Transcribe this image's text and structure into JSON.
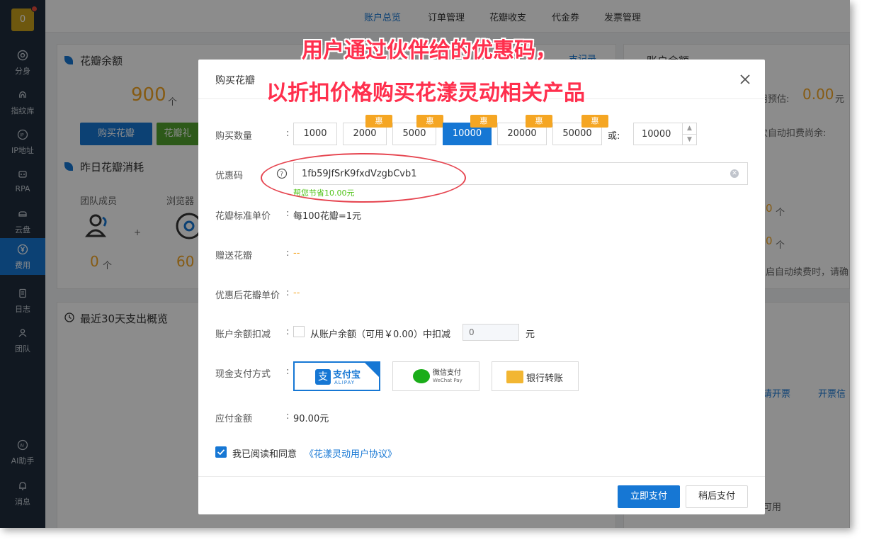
{
  "sidebar": {
    "avatar_text": "0",
    "items": [
      {
        "label": "分身",
        "icon": "chrome-icon"
      },
      {
        "label": "指纹库",
        "icon": "fingerprint-icon"
      },
      {
        "label": "IP地址",
        "icon": "ip-icon"
      },
      {
        "label": "RPA",
        "icon": "robot-icon"
      },
      {
        "label": "云盘",
        "icon": "cloud-drive-icon"
      },
      {
        "label": "费用",
        "icon": "yen-icon",
        "active": true
      },
      {
        "label": "日志",
        "icon": "document-icon"
      },
      {
        "label": "团队",
        "icon": "team-icon"
      },
      {
        "label": "AI助手",
        "icon": "ai-icon"
      },
      {
        "label": "消息",
        "icon": "bell-icon"
      }
    ]
  },
  "topnav": {
    "links": [
      "账户总览",
      "订单管理",
      "花瓣收支",
      "代金券",
      "发票管理"
    ],
    "active": "账户总览"
  },
  "background": {
    "petal_balance_title": "花瓣余额",
    "petal_balance_value": "900",
    "unit_ge": "个",
    "buy_petals_button": "购买花瓣",
    "petal_gift_button": "花瓣礼",
    "yesterday_title": "昨日花瓣消耗",
    "team_members_label": "团队成员",
    "browser_label": "浏览器",
    "team_value": "0",
    "browser_value": "60",
    "recent_title": "最近30天支出概览",
    "records_link": "支记录",
    "account_balance_title": "账户余额",
    "estimate_label": "用预估:",
    "estimate_value": "0.00",
    "unit_yuan": "元",
    "auto_deduct_text": "次自动扣费尚余:",
    "right_zero_1": "0",
    "right_zero_2": "0",
    "auto_renew_text": "启自动续费时，请确",
    "apply_invoice_link": "请开票",
    "invoice_info_link": "开票信",
    "available_text": "可用"
  },
  "modal": {
    "title": "购买花瓣",
    "quantity_label": "购买数量",
    "quantity_options": [
      "1000",
      "2000",
      "5000",
      "10000",
      "20000",
      "50000"
    ],
    "selected_quantity": "10000",
    "badge_text": "惠",
    "or_text": "或:",
    "custom_quantity": "10000",
    "coupon_label": "优惠码",
    "coupon_value": "1fb59JfSrK9fxdVzgbCvb1",
    "coupon_saving": "帮您节省10.00元",
    "unit_price_label": "花瓣标准单价",
    "unit_price_value": "每100花瓣=1元",
    "gift_label": "赠送花瓣",
    "gift_value": "--",
    "discount_price_label": "优惠后花瓣单价",
    "discount_price_value": "--",
    "balance_deduct_label": "账户余额扣减",
    "balance_deduct_text": "从账户余额（可用￥0.00）中扣减",
    "balance_deduct_amount": "0",
    "yuan": "元",
    "cash_payment_label": "现金支付方式",
    "alipay_text": "支付宝",
    "alipay_sub": "ALIPAY",
    "wechat_text": "微信支付",
    "wechat_sub": "WeChat Pay",
    "bank_text": "银行转账",
    "amount_label": "应付金额",
    "amount_value": "90.00元",
    "agree_text": "我已阅读和同意",
    "agreement_link": "《花漾灵动用户协议》",
    "pay_now": "立即支付",
    "pay_later": "稍后支付",
    "colon": ":"
  },
  "annotation": {
    "line1": "用户通过伙伴给的优惠码，",
    "line2": "以折扣价格购买花漾灵动相关产品"
  },
  "colors": {
    "primary": "#1677d4",
    "badge": "#f5a623",
    "saving_text": "#52c41a",
    "callout": "#ff2f4d"
  }
}
